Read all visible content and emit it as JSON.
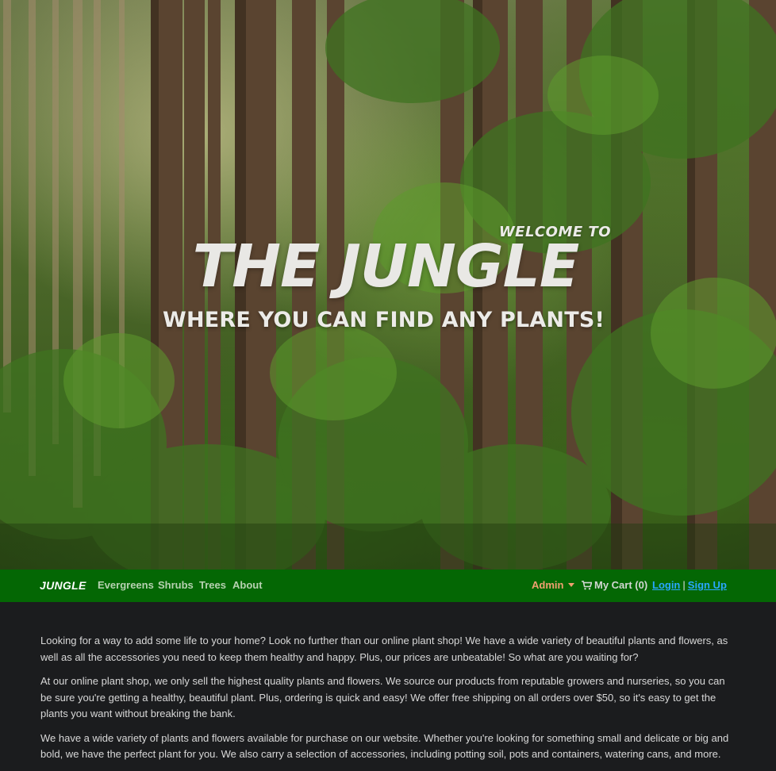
{
  "hero": {
    "welcome": "WELCOME TO",
    "title": "THE JUNGLE",
    "subtitle": "WHERE YOU CAN FIND ANY PLANTS!"
  },
  "navbar": {
    "brand": "JUNGLE",
    "links": [
      "Evergreens",
      "Shrubs",
      "Trees",
      "About"
    ],
    "admin_label": "Admin",
    "cart_label": "My Cart (0)",
    "login_label": "Login",
    "separator": "|",
    "signup_label": "Sign Up"
  },
  "content": {
    "paragraphs": [
      "Looking for a way to add some life to your home? Look no further than our online plant shop! We have a wide variety of beautiful plants and flowers, as well as all the accessories you need to keep them healthy and happy. Plus, our prices are unbeatable! So what are you waiting for?",
      "At our online plant shop, we only sell the highest quality plants and flowers. We source our products from reputable growers and nurseries, so you can be sure you're getting a healthy, beautiful plant. Plus, ordering is quick and easy! We offer free shipping on all orders over $50, so it's easy to get the plants you want without breaking the bank.",
      "We have a wide variety of plants and flowers available for purchase on our website. Whether you're looking for something small and delicate or big and bold, we have the perfect plant for you. We also carry a selection of accessories, including potting soil, pots and containers, watering cans, and more."
    ]
  },
  "colors": {
    "navbar_bg": "#046704",
    "nav_link": "#b7d1b1",
    "admin": "#f0a070",
    "auth_link": "#29a7ff",
    "content_bg": "#1b1c1e",
    "content_text": "#d8d8d8",
    "hero_text": "#e9e8e5"
  },
  "icons": {
    "cart": "shopping-cart-icon",
    "admin_dropdown": "caret-down-icon"
  }
}
